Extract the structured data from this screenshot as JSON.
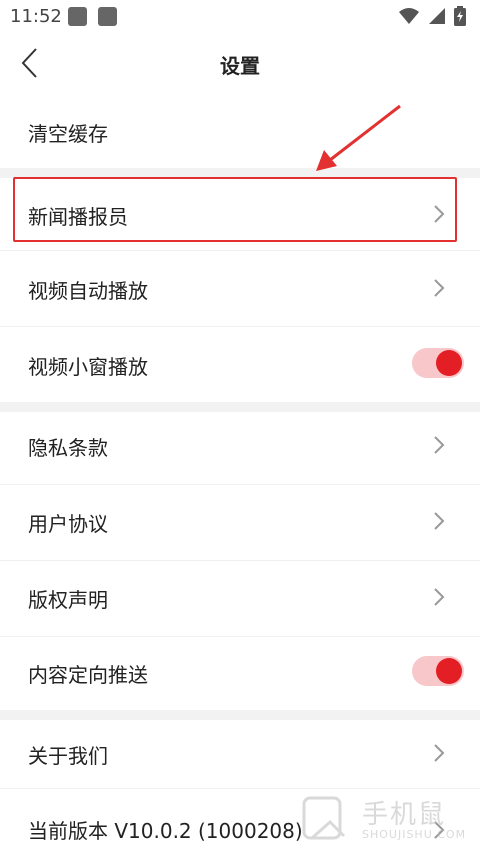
{
  "status_bar": {
    "time": "11:52"
  },
  "header": {
    "title": "设置",
    "back_icon": "chevron-left-icon"
  },
  "items": [
    {
      "label": "清空缓存",
      "control": "none"
    },
    {
      "label": "新闻播报员",
      "control": "chevron"
    },
    {
      "label": "视频自动播放",
      "control": "chevron"
    },
    {
      "label": "视频小窗播放",
      "control": "toggle",
      "on": true
    },
    {
      "label": "隐私条款",
      "control": "chevron"
    },
    {
      "label": "用户协议",
      "control": "chevron"
    },
    {
      "label": "版权声明",
      "control": "chevron"
    },
    {
      "label": "内容定向推送",
      "control": "toggle",
      "on": true
    },
    {
      "label": "关于我们",
      "control": "chevron"
    },
    {
      "label": "当前版本 V10.0.2 (1000208)",
      "control": "chevron"
    }
  ],
  "annotation": {
    "highlight_color": "#e33131"
  },
  "watermark": {
    "text": "手机鼠",
    "subtext": "SHOUJISHU.COM"
  },
  "colors": {
    "accent": "#e41e25",
    "toggle_track": "#f7c7c9",
    "section_gap": "#f2f2f2"
  }
}
